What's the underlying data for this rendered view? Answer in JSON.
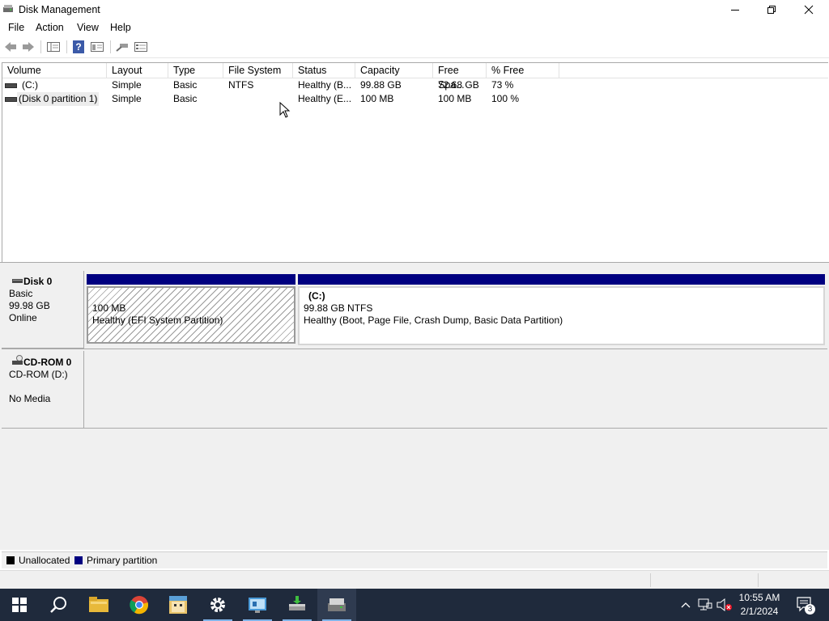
{
  "window": {
    "title": "Disk Management"
  },
  "menu": [
    "File",
    "Action",
    "View",
    "Help"
  ],
  "toolbar": {
    "buttons": [
      "back-arrow-icon",
      "forward-arrow-icon",
      "show-hide-console-tree-icon",
      "help-icon",
      "properties-icon",
      "connect-icon",
      "disk-list-icon"
    ]
  },
  "volume_table": {
    "columns": [
      "Volume",
      "Layout",
      "Type",
      "File System",
      "Status",
      "Capacity",
      "Free Spa...",
      "% Free"
    ],
    "rows": [
      {
        "volume": "(C:)",
        "layout": "Simple",
        "type": "Basic",
        "fs": "NTFS",
        "status": "Healthy (B...",
        "capacity": "99.88 GB",
        "free": "72.68 GB",
        "pct": "73 %"
      },
      {
        "volume": "(Disk 0 partition 1)",
        "layout": "Simple",
        "type": "Basic",
        "fs": "",
        "status": "Healthy (E...",
        "capacity": "100 MB",
        "free": "100 MB",
        "pct": "100 %"
      }
    ]
  },
  "disks": [
    {
      "name": "Disk 0",
      "type": "Basic",
      "size": "99.98 GB",
      "state": "Online",
      "partitions": [
        {
          "title": "",
          "size": "100 MB",
          "status": "Healthy (EFI System Partition)"
        },
        {
          "title": "(C:)",
          "size": "99.88 GB NTFS",
          "status": "Healthy (Boot, Page File, Crash Dump, Basic Data Partition)"
        }
      ]
    },
    {
      "name": "CD-ROM 0",
      "drive": "CD-ROM (D:)",
      "state": "No Media"
    }
  ],
  "legend": [
    {
      "label": "Unallocated",
      "color": "#000000"
    },
    {
      "label": "Primary partition",
      "color": "#000080"
    }
  ],
  "taskbar": {
    "apps": [
      "start-icon",
      "search-icon",
      "file-explorer-icon",
      "chrome-icon",
      "app-icon",
      "settings-icon",
      "control-panel-icon",
      "disk-tool-icon",
      "disk-management-icon"
    ],
    "time": "10:55 AM",
    "date": "2/1/2024",
    "notification_count": "3"
  }
}
